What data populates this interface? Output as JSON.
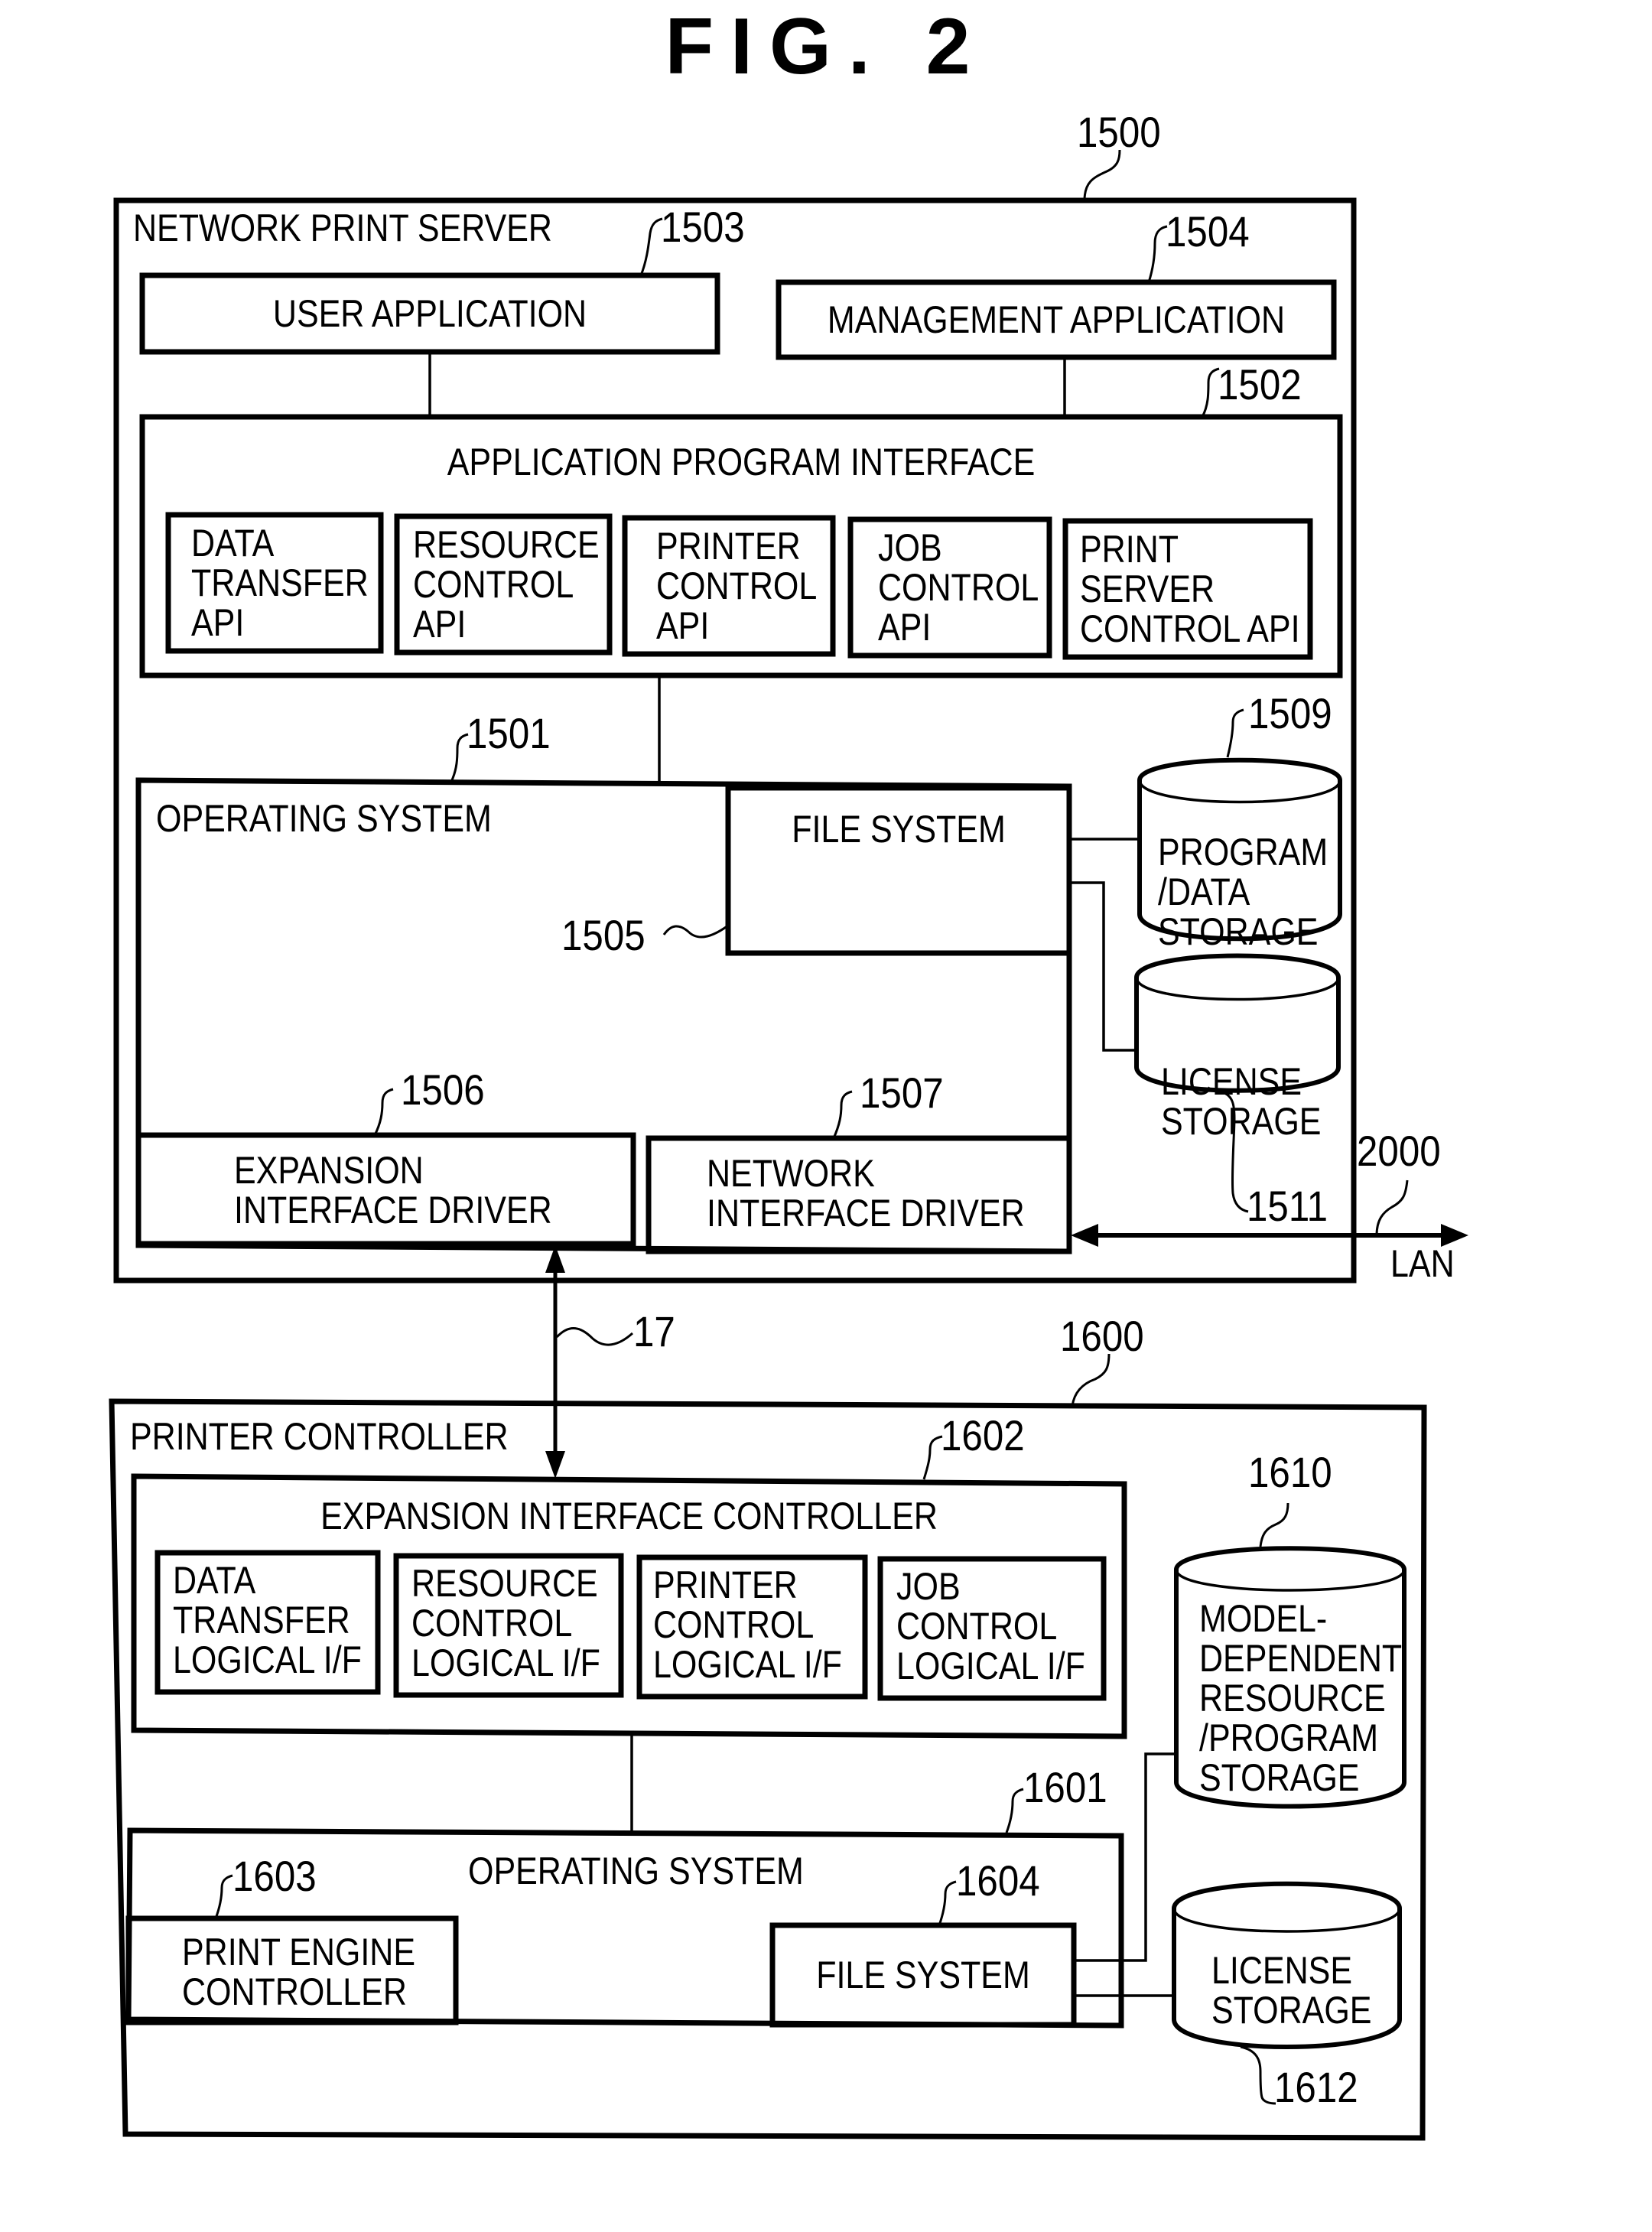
{
  "figure": {
    "title": "FIG. 2"
  },
  "server": {
    "ref": "1500",
    "label": "NETWORK PRINT SERVER",
    "user_app": {
      "ref": "1503",
      "label": "USER APPLICATION"
    },
    "mgmt_app": {
      "ref": "1504",
      "label": "MANAGEMENT APPLICATION"
    },
    "api": {
      "ref": "1502",
      "label": "APPLICATION PROGRAM INTERFACE",
      "modules": [
        {
          "label": "DATA\nTRANSFER\nAPI"
        },
        {
          "label": "RESOURCE\nCONTROL\nAPI"
        },
        {
          "label": "PRINTER\nCONTROL\nAPI"
        },
        {
          "label": "JOB\nCONTROL\nAPI"
        },
        {
          "label": "PRINT\nSERVER\nCONTROL API"
        }
      ]
    },
    "os": {
      "ref": "1501",
      "label": "OPERATING SYSTEM",
      "file_system": {
        "ref": "1505",
        "label": "FILE SYSTEM"
      },
      "expansion_driver": {
        "ref": "1506",
        "label": "EXPANSION\nINTERFACE DRIVER"
      },
      "network_driver": {
        "ref": "1507",
        "label": "NETWORK\nINTERFACE DRIVER"
      }
    },
    "program_storage": {
      "ref": "1509",
      "label": "PROGRAM\n/DATA\nSTORAGE"
    },
    "license_storage": {
      "ref": "1511",
      "label": "LICENSE\nSTORAGE"
    }
  },
  "network": {
    "ref": "2000",
    "label": "LAN"
  },
  "bus": {
    "ref": "17"
  },
  "controller": {
    "ref": "1600",
    "label": "PRINTER CONTROLLER",
    "eic": {
      "ref": "1602",
      "label": "EXPANSION INTERFACE CONTROLLER",
      "modules": [
        {
          "label": "DATA\nTRANSFER\nLOGICAL I/F"
        },
        {
          "label": "RESOURCE\nCONTROL\nLOGICAL I/F"
        },
        {
          "label": "PRINTER\nCONTROL\nLOGICAL I/F"
        },
        {
          "label": "JOB\nCONTROL\nLOGICAL I/F"
        }
      ]
    },
    "os": {
      "ref": "1601",
      "label": "OPERATING SYSTEM",
      "engine": {
        "ref": "1603",
        "label": "PRINT ENGINE\nCONTROLLER"
      },
      "file_system": {
        "ref": "1604",
        "label": "FILE SYSTEM"
      }
    },
    "model_storage": {
      "ref": "1610",
      "label": "MODEL-\nDEPENDENT\nRESOURCE\n/PROGRAM\nSTORAGE"
    },
    "license_storage": {
      "ref": "1612",
      "label": "LICENSE\nSTORAGE"
    }
  }
}
